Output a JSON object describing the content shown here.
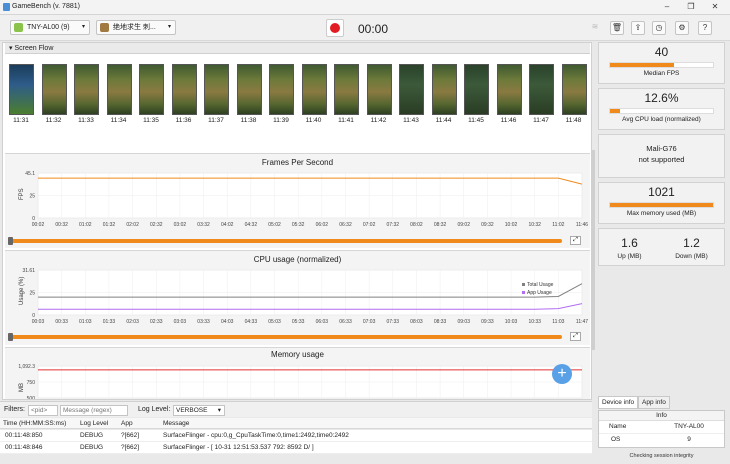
{
  "window": {
    "title": "GameBench (v. 7881)"
  },
  "toolbar": {
    "device": "TNY-AL00 (9)",
    "app": "绝地求生 刺...",
    "timer": "00:00"
  },
  "screen_flow": {
    "label": "Screen Flow",
    "times": [
      "11:31",
      "11:32",
      "11:33",
      "11:34",
      "11:35",
      "11:36",
      "11:37",
      "11:38",
      "11:39",
      "11:40",
      "11:41",
      "11:42",
      "11:43",
      "11:44",
      "11:45",
      "11:46",
      "11:47",
      "11:48"
    ]
  },
  "charts": {
    "fps": {
      "title": "Frames Per Second",
      "ylabel": "FPS",
      "yticks": [
        "45.1",
        "25",
        "0"
      ],
      "xticks": [
        "00:02",
        "00:32",
        "01:02",
        "01:32",
        "02:02",
        "02:32",
        "03:02",
        "03:32",
        "04:02",
        "04:32",
        "05:02",
        "05:32",
        "06:02",
        "06:32",
        "07:02",
        "07:32",
        "08:02",
        "08:32",
        "09:02",
        "09:32",
        "10:02",
        "10:32",
        "11:02",
        "11:46"
      ]
    },
    "cpu": {
      "title": "CPU usage (normalized)",
      "ylabel": "Usage (%)",
      "yticks": [
        "31.61",
        "25",
        "0"
      ],
      "xticks": [
        "00:03",
        "00:33",
        "01:03",
        "01:33",
        "02:03",
        "02:33",
        "03:03",
        "03:33",
        "04:03",
        "04:33",
        "05:03",
        "05:33",
        "06:03",
        "06:33",
        "07:03",
        "07:33",
        "08:03",
        "08:33",
        "09:03",
        "09:33",
        "10:03",
        "10:33",
        "11:03",
        "11:47"
      ],
      "legend": [
        "Total Usage",
        "App Usage"
      ]
    },
    "memory": {
      "title": "Memory usage",
      "ylabel": "MB",
      "yticks": [
        "1,092.3",
        "750",
        "500"
      ]
    }
  },
  "chart_data": [
    {
      "type": "line",
      "title": "Frames Per Second",
      "ylabel": "FPS",
      "ylim": [
        0,
        45.1
      ],
      "series": [
        {
          "values": [
            40,
            40,
            40,
            40,
            40,
            40,
            40,
            40,
            40,
            40,
            40,
            40,
            40,
            40,
            40,
            40,
            40,
            40,
            40,
            40,
            40,
            40,
            40,
            34
          ]
        }
      ]
    },
    {
      "type": "line",
      "title": "CPU usage (normalized)",
      "ylabel": "Usage (%)",
      "ylim": [
        0,
        31.61
      ],
      "series": [
        {
          "name": "Total Usage",
          "values": [
            12.6,
            12.6,
            12.6,
            12.6,
            12.6,
            12.6,
            12.6,
            12.6,
            12.6,
            12.6,
            12.6,
            12.6,
            12.6,
            12.6,
            12.6,
            12.6,
            12.6,
            12.6,
            12.6,
            12.6,
            12.6,
            12.6,
            13,
            22
          ]
        },
        {
          "name": "App Usage",
          "values": [
            4,
            4,
            4,
            4,
            4,
            4,
            4,
            4,
            4,
            4,
            4,
            4,
            4,
            4,
            4,
            4,
            4,
            4,
            4,
            4,
            4,
            4,
            4.5,
            8
          ]
        }
      ]
    },
    {
      "type": "line",
      "title": "Memory usage",
      "ylabel": "MB",
      "ylim": [
        500,
        1092.3
      ],
      "series": [
        {
          "values": [
            1021,
            1021,
            1021,
            1021,
            1021,
            1021
          ]
        }
      ]
    }
  ],
  "filters": {
    "label": "Filters:",
    "pid_placeholder": "<pid>",
    "msg_placeholder": "Message (regex)",
    "log_level_label": "Log Level:",
    "log_level": "VERBOSE"
  },
  "log": {
    "headers": [
      "Time (HH:MM:SS:ms)",
      "Log Level",
      "App",
      "Message"
    ],
    "rows": [
      [
        "00:11:48:850",
        "DEBUG",
        "?[662]",
        "SurfaceFlinger - cpu:0,g_CpuTaskTime:0,time1:2492,time0:2492"
      ],
      [
        "00:11:48:846",
        "DEBUG",
        "?[662]",
        "SurfaceFlinger - [ 10-31 12:51:53.537   792: 8592 D/      ]"
      ]
    ]
  },
  "metrics": {
    "fps": {
      "value": "40",
      "label": "Median FPS",
      "fill": 0.62
    },
    "cpu": {
      "value": "12.6%",
      "label": "Avg CPU load (normalized)",
      "fill": 0.1
    },
    "gpu": {
      "line1": "Mali-G76",
      "line2": "not supported"
    },
    "mem": {
      "value": "1021",
      "label": "Max memory used (MB)",
      "fill": 1.0
    },
    "net": {
      "up": "1.6",
      "up_label": "Up (MB)",
      "down": "1.2",
      "down_label": "Down (MB)"
    }
  },
  "device_info": {
    "tabs": [
      "Device info",
      "App info"
    ],
    "header": "Info",
    "rows": [
      [
        "Name",
        "TNY-AL00"
      ],
      [
        "OS",
        "9"
      ]
    ]
  },
  "status": "Checking session integrity",
  "colors": {
    "accent": "#f08a1c",
    "total_usage": "#808080",
    "app_usage": "#b26cf0",
    "memory": "#e03030",
    "record": "#e31b23"
  }
}
